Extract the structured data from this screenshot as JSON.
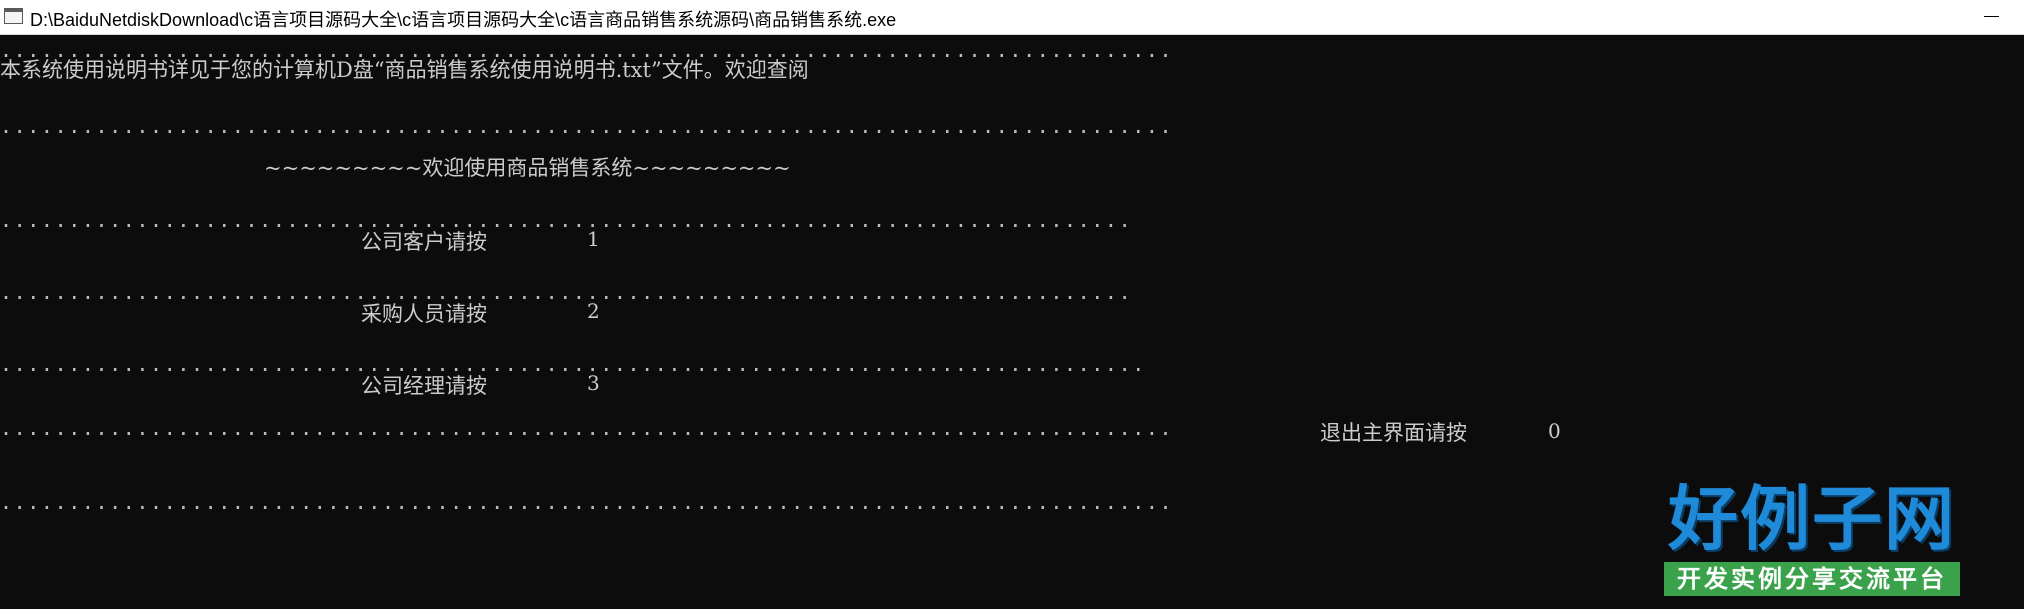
{
  "window": {
    "title": "D:\\BaiduNetdiskDownload\\c语言项目源码大全\\c语言项目源码大全\\c语言商品销售系统源码\\商品销售系统.exe"
  },
  "console": {
    "dot_line_1": "......................................................................................",
    "notice": "本系统使用说明书详见于您的计算机D盘“商品销售系统使用说明书.txt”文件。欢迎查阅",
    "dot_line_2": "......................................................................................",
    "welcome": "~~~~~~~~~欢迎使用商品销售系统~~~~~~~~~",
    "dot_line_3": "...................................................................................",
    "menu_customer_label": "公司客户请按",
    "menu_customer_key": "1",
    "dot_line_4": "...................................................................................",
    "menu_purchaser_label": "采购人员请按",
    "menu_purchaser_key": "2",
    "dot_line_5": "....................................................................................",
    "menu_manager_label": "公司经理请按",
    "menu_manager_key": "3",
    "dot_line_6": "......................................................................................",
    "menu_exit_label": "退出主界面请按",
    "menu_exit_key": "0",
    "dot_line_7": "......................................................................................"
  },
  "watermark": {
    "main": "好例子网",
    "sub": "开发实例分享交流平台"
  },
  "colors": {
    "console_bg": "#0c0c0c",
    "console_fg": "#cccccc",
    "watermark_blue": "#1f8ad8",
    "watermark_green": "#3aa24a"
  }
}
